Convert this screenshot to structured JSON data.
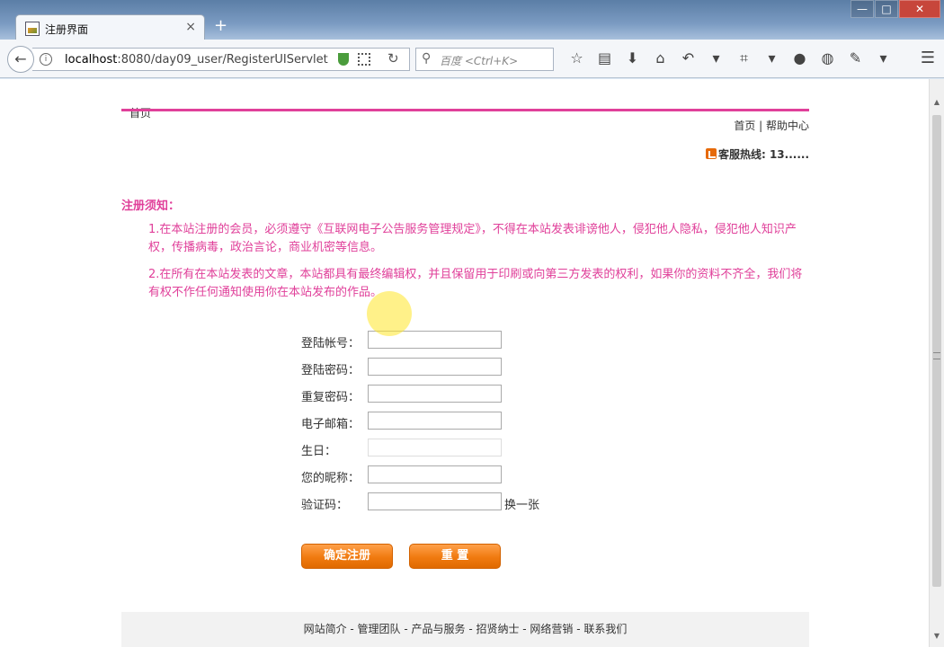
{
  "browser": {
    "tab_title": "注册界面",
    "tab_close": "×",
    "new_tab": "+",
    "window_controls": {
      "minimize": "—",
      "maximize": "□",
      "close": "✕"
    },
    "url_host": "localhost",
    "url_rest": ":8080/day09_user/RegisterUIServlet",
    "search_placeholder": "百度 <Ctrl+K>",
    "toolbar_icons": [
      "star-icon",
      "reading-list-icon",
      "download-icon",
      "home-icon",
      "undo-icon",
      "dropdown-icon",
      "crop-icon",
      "dropdown-icon",
      "chat-icon",
      "palette-icon",
      "extension-icon",
      "dropdown-icon"
    ]
  },
  "page": {
    "top_nav": "首页",
    "header_links": "首页 | 帮助中心",
    "hotline": "客服热线: 13......",
    "notice_title": "注册须知：",
    "notice_1": "1.在本站注册的会员，必须遵守《互联网电子公告服务管理规定》，不得在本站发表诽谤他人，侵犯他人隐私，侵犯他人知识产权，传播病毒，政治言论，商业机密等信息。",
    "notice_2": "2.在所有在本站发表的文章，本站都具有最终编辑权，并且保留用于印刷或向第三方发表的权利，如果你的资料不齐全，我们将有权不作任何通知使用你在本站发布的作品。",
    "form": {
      "username_label": "登陆帐号：",
      "password_label": "登陆密码：",
      "password2_label": "重复密码：",
      "email_label": "电子邮箱：",
      "birthday_label": "生日：",
      "nickname_label": "您的昵称：",
      "captcha_label": "验证码：",
      "captcha_refresh": "换一张"
    },
    "submit_label": "确定注册",
    "reset_label": "重 置",
    "footer": "网站简介 - 管理团队 - 产品与服务 - 招贤纳士 - 网络营销 - 联系我们"
  }
}
